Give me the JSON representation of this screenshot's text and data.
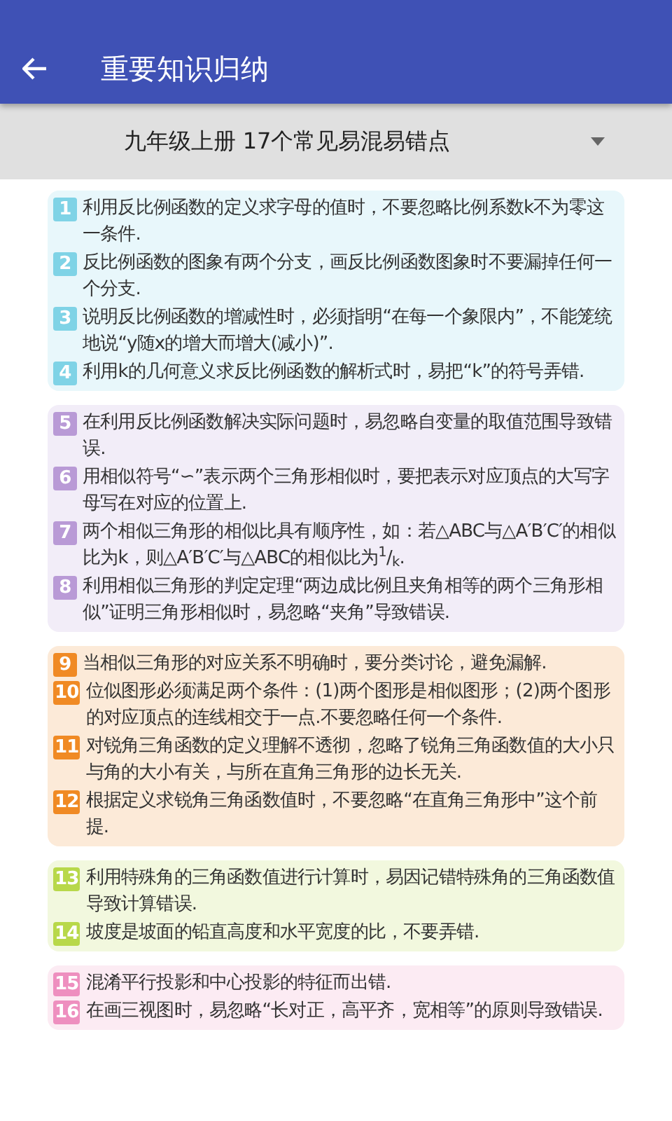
{
  "app_bar": {
    "title": "重要知识归纳"
  },
  "dropdown": {
    "value": "九年级上册 17个常见易混易错点"
  },
  "groups": [
    {
      "color": "#7fd3e6",
      "items": [
        {
          "number": "1",
          "text": "利用反比例函数的定义求字母的值时，不要忽略比例系数k不为零这一条件."
        },
        {
          "number": "2",
          "text": "反比例函数的图象有两个分支，画反比例函数图象时不要漏掉任何一个分支."
        },
        {
          "number": "3",
          "text": "说明反比例函数的增减性时，必须指明“在每一个象限内”，不能笼统地说“y随x的增大而增大(减小)”."
        },
        {
          "number": "4",
          "text": "利用k的几何意义求反比例函数的解析式时，易把“k”的符号弄错."
        }
      ]
    },
    {
      "color": "#b99ad6",
      "items": [
        {
          "number": "5",
          "text": "在利用反比例函数解决实际问题时，易忽略自变量的取值范围导致错误."
        },
        {
          "number": "6",
          "text": "用相似符号“∽”表示两个三角形相似时，要把表示对应顶点的大写字母写在对应的位置上."
        },
        {
          "number": "7",
          "text": "两个相似三角形的相似比具有顺序性，如：若△ABC与△A′B′C′的相似比为k，则△A′B′C′与△ABC的相似比为$^{1}$/$_{k}$."
        },
        {
          "number": "8",
          "text": "利用相似三角形的判定定理“两边成比例且夹角相等的两个三角形相似”证明三角形相似时，易忽略“夹角”导致错误."
        }
      ]
    },
    {
      "color": "#f08a24",
      "items": [
        {
          "number": "9",
          "text": "当相似三角形的对应关系不明确时，要分类讨论，避免漏解."
        },
        {
          "number": "10",
          "text": "位似图形必须满足两个条件：(1)两个图形是相似图形；(2)两个图形的对应顶点的连线相交于一点.不要忽略任何一个条件."
        },
        {
          "number": "11",
          "text": "对锐角三角函数的定义理解不透彻，忽略了锐角三角函数值的大小只与角的大小有关，与所在直角三角形的边长无关."
        },
        {
          "number": "12",
          "text": "根据定义求锐角三角函数值时，不要忽略“在直角三角形中”这个前提."
        }
      ]
    },
    {
      "color": "#b8d84a",
      "items": [
        {
          "number": "13",
          "text": "利用特殊角的三角函数值进行计算时，易因记错特殊角的三角函数值导致计算错误."
        },
        {
          "number": "14",
          "text": "坡度是坡面的铅直高度和水平宽度的比，不要弄错."
        }
      ]
    },
    {
      "color": "#ee8fbf",
      "items": [
        {
          "number": "15",
          "text": "混淆平行投影和中心投影的特征而出错."
        },
        {
          "number": "16",
          "text": "在画三视图时，易忽略“长对正，高平齐，宽相等”的原则导致错误."
        }
      ]
    }
  ]
}
